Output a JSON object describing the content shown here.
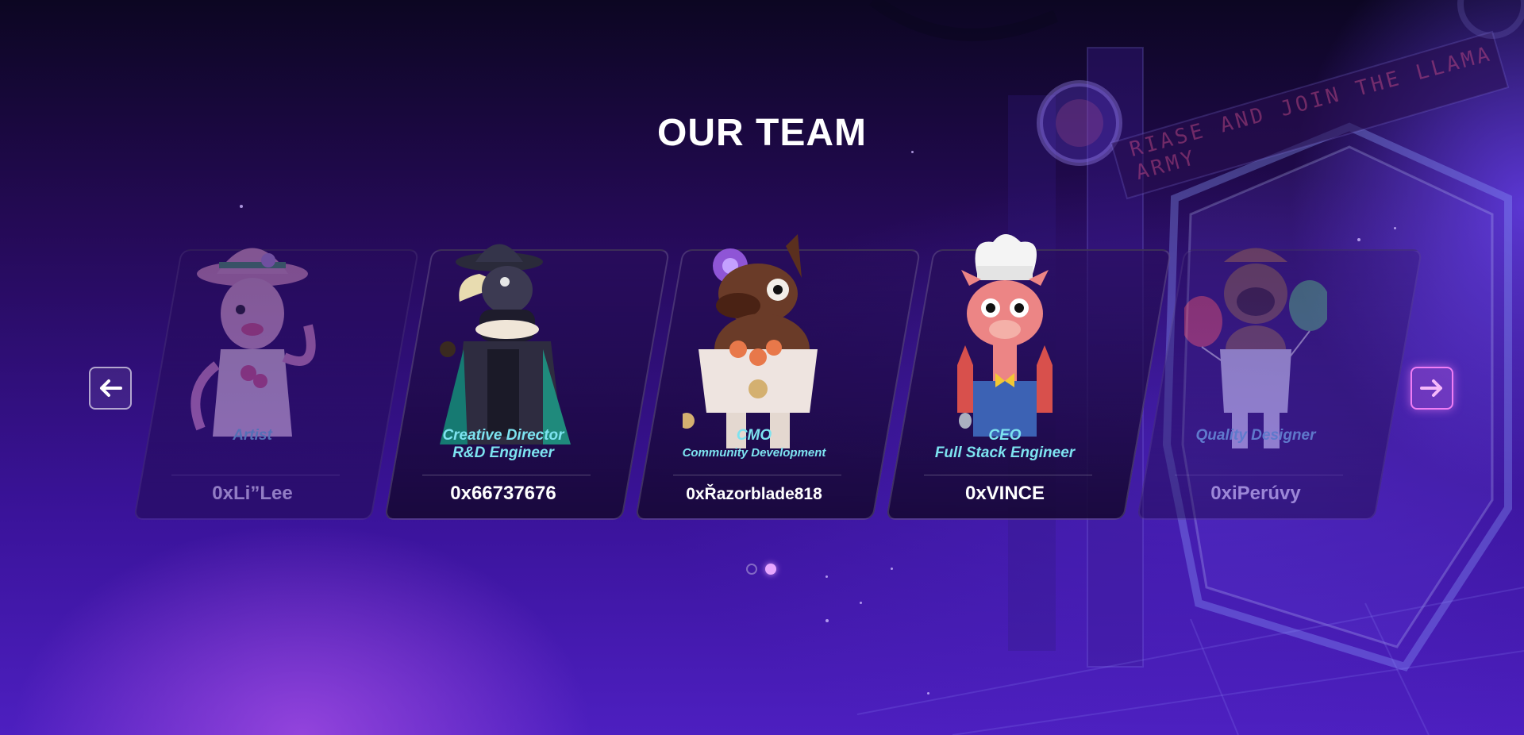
{
  "page": {
    "title": "OUR TEAM",
    "sign_text": "RIASE AND JOIN THE LLAMA ARMY"
  },
  "navigation": {
    "prev_icon": "arrow-left-icon",
    "next_icon": "arrow-right-icon"
  },
  "team": [
    {
      "role_line1": "Artist",
      "role_line2": "",
      "handle": "0xLi”Lee",
      "avatar": "octopus-avatar",
      "state": "faded"
    },
    {
      "role_line1": "Creative Director",
      "role_line2": "R&D Engineer",
      "handle": "0x66737676",
      "avatar": "plague-doctor-avatar",
      "state": "visible"
    },
    {
      "role_line1": "CMO",
      "role_line2": "Community Development",
      "handle": "0xŘazorblade818",
      "avatar": "horse-avatar",
      "state": "visible"
    },
    {
      "role_line1": "CEO",
      "role_line2": "Full Stack Engineer",
      "handle": "0xVINCE",
      "avatar": "chef-llama-avatar",
      "state": "visible"
    },
    {
      "role_line1": "Quality Designer",
      "role_line2": "",
      "handle": "0xiPerúvy",
      "avatar": "balloon-llama-avatar",
      "state": "faded"
    }
  ],
  "pagination": {
    "count": 2,
    "active": 2
  },
  "colors": {
    "accent": "#f07df5",
    "role_text": "#7de3f0",
    "background": "#3a139a"
  }
}
